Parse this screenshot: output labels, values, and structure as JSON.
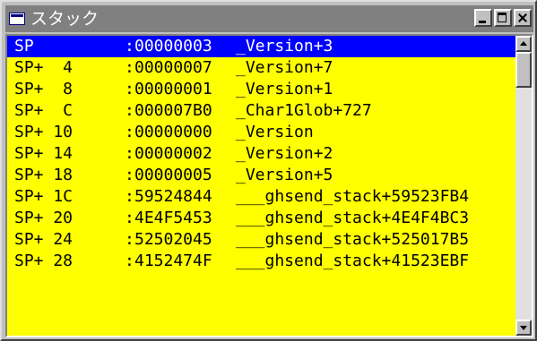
{
  "window": {
    "title": "スタック",
    "icon": "window-icon",
    "controls": {
      "minimize": "minimize-icon",
      "maximize": "maximize-icon",
      "close": "close-icon"
    },
    "colors": {
      "list_background": "#ffff00",
      "selection": "#0000ff",
      "titlebar": "#808080"
    }
  },
  "stack": {
    "selected_index": 0,
    "rows": [
      {
        "offset": "SP",
        "sep": ":",
        "value": "00000003",
        "symbol": "_Version+3"
      },
      {
        "offset": "SP+  4",
        "sep": ":",
        "value": "00000007",
        "symbol": "_Version+7"
      },
      {
        "offset": "SP+  8",
        "sep": ":",
        "value": "00000001",
        "symbol": "_Version+1"
      },
      {
        "offset": "SP+  C",
        "sep": ":",
        "value": "000007B0",
        "symbol": "_Char1Glob+727"
      },
      {
        "offset": "SP+ 10",
        "sep": ":",
        "value": "00000000",
        "symbol": "_Version"
      },
      {
        "offset": "SP+ 14",
        "sep": ":",
        "value": "00000002",
        "symbol": "_Version+2"
      },
      {
        "offset": "SP+ 18",
        "sep": ":",
        "value": "00000005",
        "symbol": "_Version+5"
      },
      {
        "offset": "SP+ 1C",
        "sep": ":",
        "value": "59524844",
        "symbol": "___ghsend_stack+59523FB4"
      },
      {
        "offset": "SP+ 20",
        "sep": ":",
        "value": "4E4F5453",
        "symbol": "___ghsend_stack+4E4F4BC3"
      },
      {
        "offset": "SP+ 24",
        "sep": ":",
        "value": "52502045",
        "symbol": "___ghsend_stack+525017B5"
      },
      {
        "offset": "SP+ 28",
        "sep": ":",
        "value": "4152474F",
        "symbol": "___ghsend_stack+41523EBF"
      }
    ]
  }
}
